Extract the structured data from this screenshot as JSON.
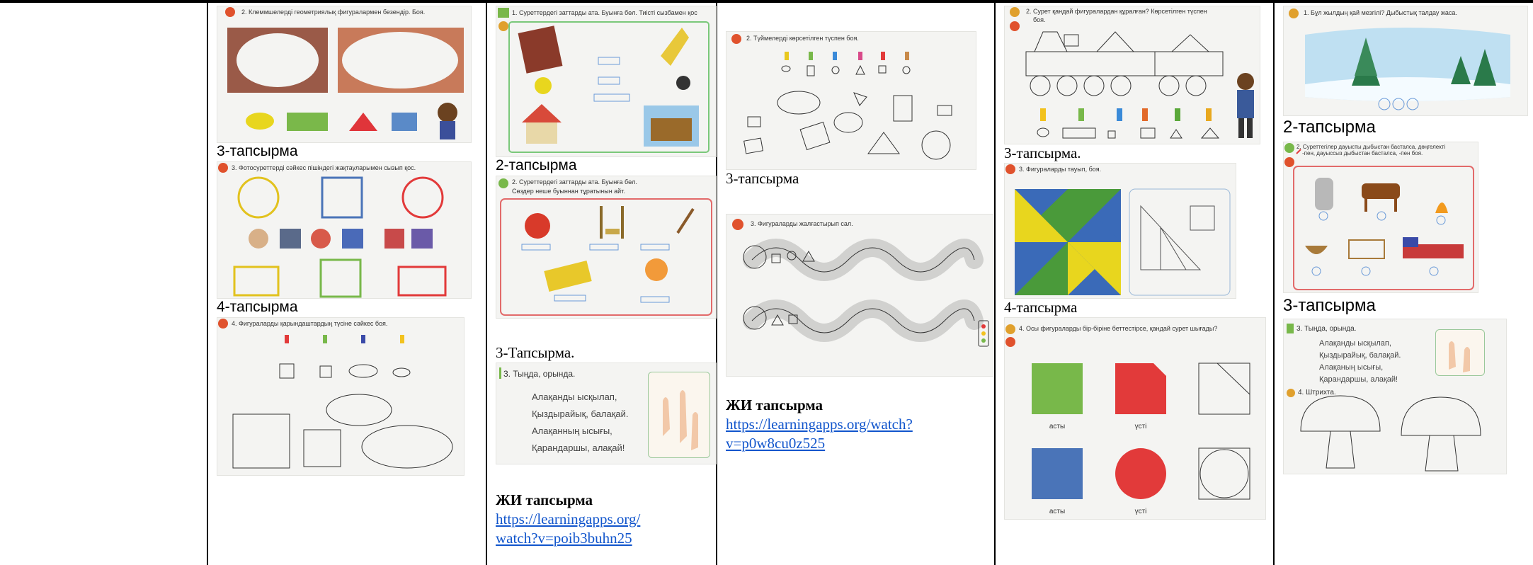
{
  "col1": {
    "img1": {
      "task": "2. Клеммшелерді геометриялық фигуралармен безендір. Боя."
    },
    "label2": "3-тапсырма",
    "img2": {
      "task": "3. Фотосуреттерді сәйкес пішіндегі жақтауларымен сызып қос."
    },
    "label3": "4-тапсырма",
    "img3": {
      "task": "4. Фигураларды қарындаштардың түсіне сәйкес боя."
    }
  },
  "col2": {
    "img1": {
      "task": "1. Суреттердегі заттарды ата. Буынға бөл. Тиісті сызбамен қос"
    },
    "label2": "2-тапсырма",
    "img2": {
      "task1": "2. Суреттердегі заттарды ата. Буынға бөл.",
      "task2": "Сөздер неше буыннан тұратынын айт."
    },
    "label3": "3-Тапсырма.",
    "img3": {
      "task": "3. Тыңда, орында.",
      "poem": [
        "Алақанды ысқылап,",
        "Қыздырайық, балақай.",
        "Алақанның ысығы,",
        "Қарандаршы, алақай!"
      ]
    },
    "ai_title": "ЖИ тапсырма",
    "ai_link": "https://learningapps.org/watch?v=poib3buhn25",
    "ai_link_lines": [
      "https://learningapps.org/",
      "watch?v=poib3buhn25"
    ]
  },
  "col3": {
    "img1": {
      "task": "2. Түймелерді көрсетілген түспен боя."
    },
    "label2": "3-тапсырма",
    "img2": {
      "task": "3. Фигураларды жалғастырып сал."
    },
    "ai_title": "ЖИ тапсырма",
    "ai_link": "https://learningapps.org/watch?v=p0w8cu0z525",
    "ai_link_lines": [
      "https://learningapps.org/watch?",
      "v=p0w8cu0z525"
    ]
  },
  "col4": {
    "img1": {
      "task1": "2. Сурет қандай фигуралардан құралған? Көрсетілген түспен",
      "task2": "боя."
    },
    "label2": "3-тапсырма.",
    "img2": {
      "task": "3. Фигураларды тауып, боя."
    },
    "label3": "4-тапсырма",
    "img3": {
      "task": "4. Осы фигураларды бір-біріне беттестірсе, қандай сурет шығады?",
      "labels": [
        "асты",
        "үсті",
        "асты",
        "үсті"
      ]
    }
  },
  "col5": {
    "img1": {
      "task": "1. Бұл жылдың қай мезгілі? Дыбыстық талдау жаса."
    },
    "label2": "2-тапсырма",
    "img2": {
      "task1": "2. Суреттегілер дауысты дыбыстан басталса, дөңгелекті",
      "task2": "-пен, дауыссыз дыбыстан басталса, -пен боя."
    },
    "label3": "3-тапсырма",
    "img3": {
      "task": "3. Тыңда, орында.",
      "poem": [
        "Алақанды ысқылап,",
        "Қыздырайық, балақай.",
        "Алақаның ысығы,",
        "Қарандаршы, алақай!"
      ],
      "task2": "4. Штрихта."
    }
  },
  "colors": {
    "green": "#78b84a",
    "red": "#e23a3a",
    "blue": "#4a74b8",
    "yellow": "#f2d21e",
    "link": "#1155cc"
  }
}
